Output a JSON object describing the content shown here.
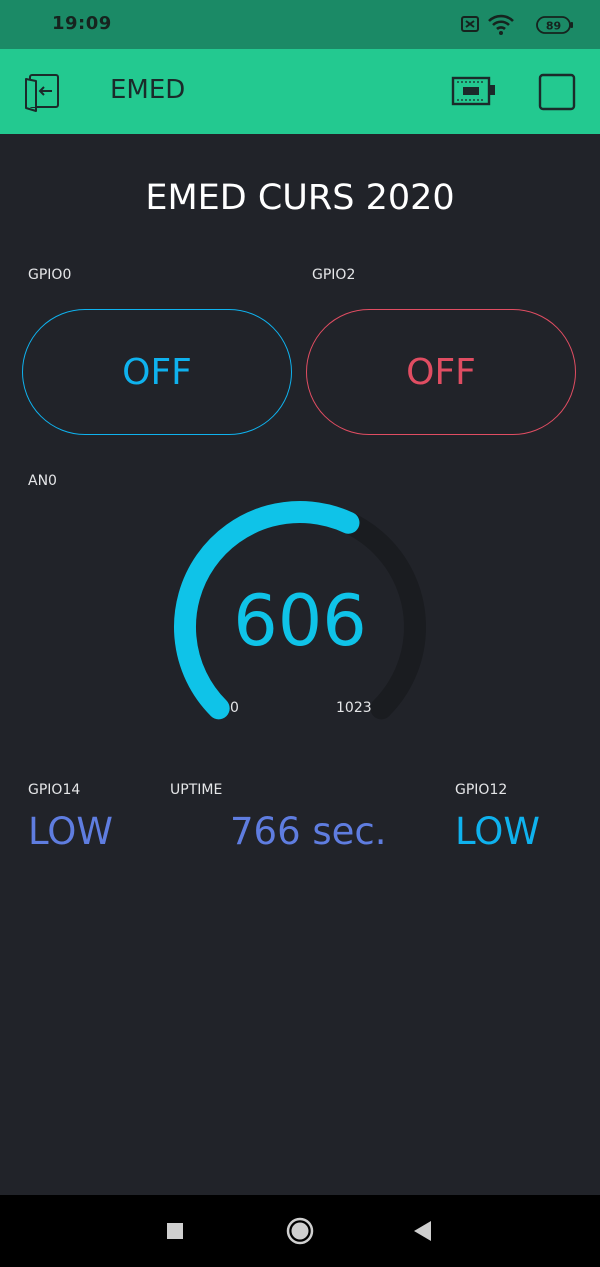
{
  "status_bar": {
    "time": "19:09",
    "battery": "89",
    "icons": [
      "notification-blocked-icon",
      "wifi-icon",
      "battery-icon"
    ]
  },
  "app_bar": {
    "title": "EMED",
    "icons": [
      "back-icon",
      "device-icon",
      "stop-icon"
    ]
  },
  "project": {
    "title": "EMED CURS 2020"
  },
  "buttons": [
    {
      "label": "GPIO0",
      "state": "OFF",
      "color": "#0fb2ee"
    },
    {
      "label": "GPIO2",
      "state": "OFF",
      "color": "#e04d62"
    }
  ],
  "gauge": {
    "label": "AN0",
    "value": 606,
    "value_text": "606",
    "min": "0",
    "max": "1023",
    "color": "#0fc3e8",
    "track_color": "#1a1c20"
  },
  "displays": [
    {
      "label": "GPIO14",
      "value": "LOW",
      "color": "#5f7de0"
    },
    {
      "label": "UPTIME",
      "value": "766 sec.",
      "color": "#5f7de0"
    },
    {
      "label": "GPIO12",
      "value": "LOW",
      "color": "#0fb2ee"
    }
  ],
  "nav_bar": {
    "icons": [
      "recent-apps-icon",
      "home-icon",
      "back-nav-icon"
    ]
  },
  "colors": {
    "status_bar": "#1b8a66",
    "app_bar": "#23c990",
    "background": "#212329"
  }
}
